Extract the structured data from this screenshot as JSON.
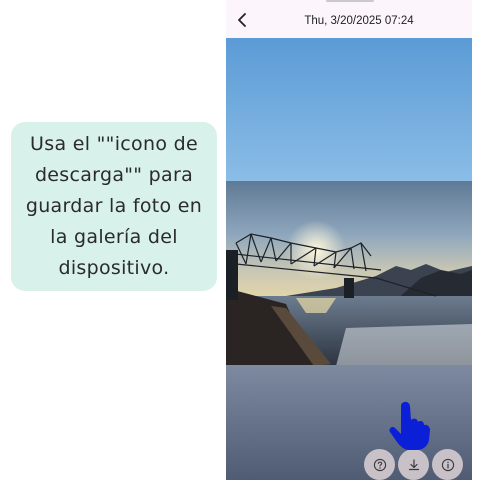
{
  "instruction": {
    "text": "Usa el \"\"icono de descarga\"\" para guardar la foto en la galería del dispositivo."
  },
  "viewer": {
    "timestamp": "Thu, 3/20/2025  07:24",
    "actions": [
      {
        "name": "help-button",
        "icon": "question-circle-icon"
      },
      {
        "name": "download-button",
        "icon": "download-icon"
      },
      {
        "name": "info-button",
        "icon": "info-circle-icon"
      }
    ]
  },
  "colors": {
    "callout_bg": "#d8f1ea",
    "topbar_bg": "#fcf5fb",
    "pointer": "#0a1fd6",
    "fab_bg": "#c9c1c8"
  }
}
